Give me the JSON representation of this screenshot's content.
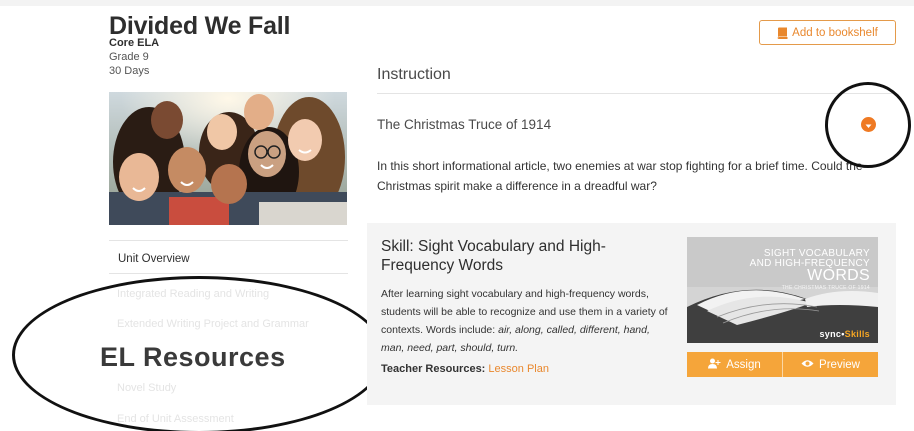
{
  "unit": {
    "title": "Divided We Fall",
    "course": "Core ELA",
    "grade": "Grade 9",
    "days": "30 Days"
  },
  "nav": {
    "items": [
      {
        "label": "Unit Overview"
      },
      {
        "label": "Integrated Reading and Writing"
      },
      {
        "label": "Extended Writing Project and Grammar"
      },
      {
        "label": "EL Resources"
      },
      {
        "label": "Novel Study"
      },
      {
        "label": "End of Unit Assessment"
      }
    ]
  },
  "toolbar": {
    "bookshelf_label": "Add to bookshelf"
  },
  "main": {
    "section_heading": "Instruction",
    "lesson_title": "The Christmas Truce of 1914",
    "lesson_description": "In this short informational article, two enemies at war stop fighting for a brief time. Could the Christmas spirit make a difference in a dreadful war?"
  },
  "skill": {
    "title": "Skill: Sight Vocabulary and High-Frequency Words",
    "desc_text": "After learning sight vocabulary and high-frequency words, students will be able to recognize and use them in a variety of contexts. Words include: ",
    "desc_words": "air, along, called, different, hand, man, need, part, should, turn.",
    "teacher_label": "Teacher Resources:",
    "teacher_link": "Lesson Plan",
    "thumb": {
      "line1": "SIGHT VOCABULARY",
      "line2": "AND HIGH-FREQUENCY",
      "line3": "WORDS",
      "line4": "THE CHRISTMAS TRUCE OF 1914",
      "brand_a": "sync",
      "brand_b": "Skills"
    },
    "assign_label": "Assign",
    "preview_label": "Preview"
  },
  "colors": {
    "accent": "#ef7a23",
    "button": "#f5a53a",
    "card_bg": "#f4f4f4"
  }
}
